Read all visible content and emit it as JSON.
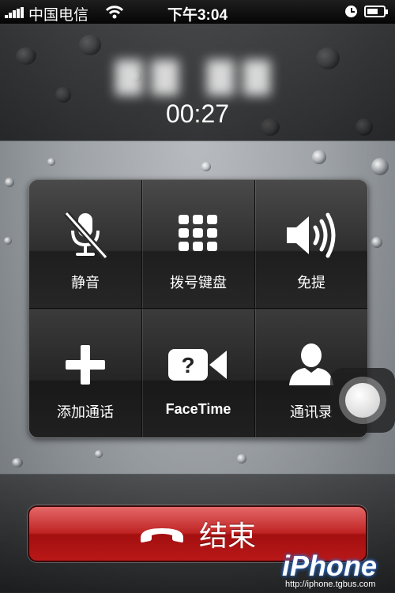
{
  "status_bar": {
    "carrier": "中国电信",
    "time": "下午3:04"
  },
  "call": {
    "duration": "00:27"
  },
  "controls": [
    {
      "label": "静音",
      "icon": "mute-microphone-icon"
    },
    {
      "label": "拨号键盘",
      "icon": "keypad-icon"
    },
    {
      "label": "免提",
      "icon": "speaker-icon"
    },
    {
      "label": "添加通话",
      "icon": "add-call-icon"
    },
    {
      "label": "FaceTime",
      "icon": "facetime-icon"
    },
    {
      "label": "通讯录",
      "icon": "contacts-icon"
    }
  ],
  "end_call": {
    "label": "结束"
  },
  "watermark": {
    "logo": "iPhone",
    "url": "http://iphone.tgbus.com"
  },
  "colors": {
    "end_button": "#c02424",
    "panel": "#2a2a2a"
  }
}
